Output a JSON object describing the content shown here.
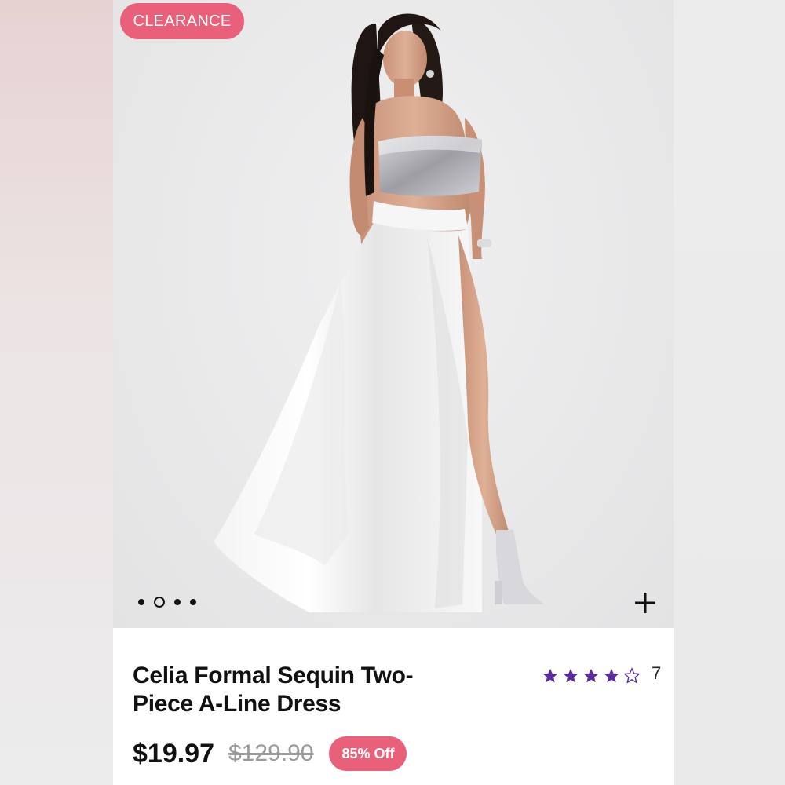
{
  "badge": {
    "label": "CLEARANCE"
  },
  "gallery": {
    "image_count": 4,
    "active_index": 1,
    "expand_icon": "plus-icon"
  },
  "product": {
    "title": "Celia Formal Sequin Two-Piece A-Line Dress",
    "rating": {
      "value": 4,
      "max": 5,
      "count": "7"
    },
    "price": "$19.97",
    "original_price": "$129.90",
    "discount": "85% Off"
  },
  "colors": {
    "accent": "#e8607a",
    "star": "#5b2d9c",
    "text": "#111111",
    "muted": "#9b9b9b"
  }
}
